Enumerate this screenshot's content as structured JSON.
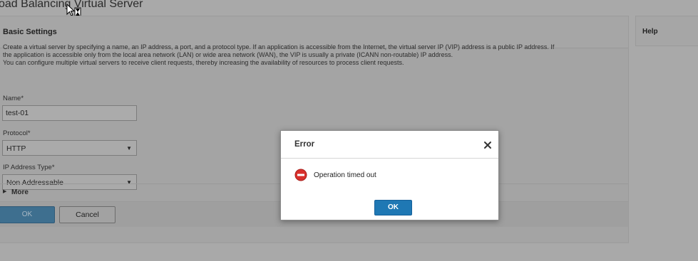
{
  "page": {
    "title": "oad Balancing Virtual Server"
  },
  "panel": {
    "header": "Basic Settings",
    "description": [
      "Create a virtual server by specifying a name, an IP address, a port, and a protocol type. If an application is accessible from the Internet, the virtual server IP (VIP) address is a public IP address. If",
      "the application is accessible only from the local area network (LAN) or wide area network (WAN), the VIP is usually a private (ICANN non-routable) IP address.",
      "You can configure multiple virtual servers to receive client requests, thereby increasing the availability of resources to process client requests."
    ],
    "fields": {
      "name": {
        "label": "Name*",
        "value": "test-01"
      },
      "protocol": {
        "label": "Protocol*",
        "value": "HTTP"
      },
      "ip_type": {
        "label": "IP Address Type*",
        "value": "Non Addressable"
      }
    },
    "more_label": "More",
    "ok_label": "OK",
    "cancel_label": "Cancel"
  },
  "help": {
    "label": "Help"
  },
  "dialog": {
    "title": "Error",
    "message": "Operation timed out",
    "ok_label": "OK"
  },
  "icons": {
    "cursor": "busy-cursor-icon",
    "error": "error-stop-icon",
    "close": "close-icon",
    "caret": "chevron-down-icon",
    "expand": "triangle-right-icon"
  },
  "colors": {
    "dialog_ok": "#1f78b4",
    "error_icon": "#d9302c"
  }
}
